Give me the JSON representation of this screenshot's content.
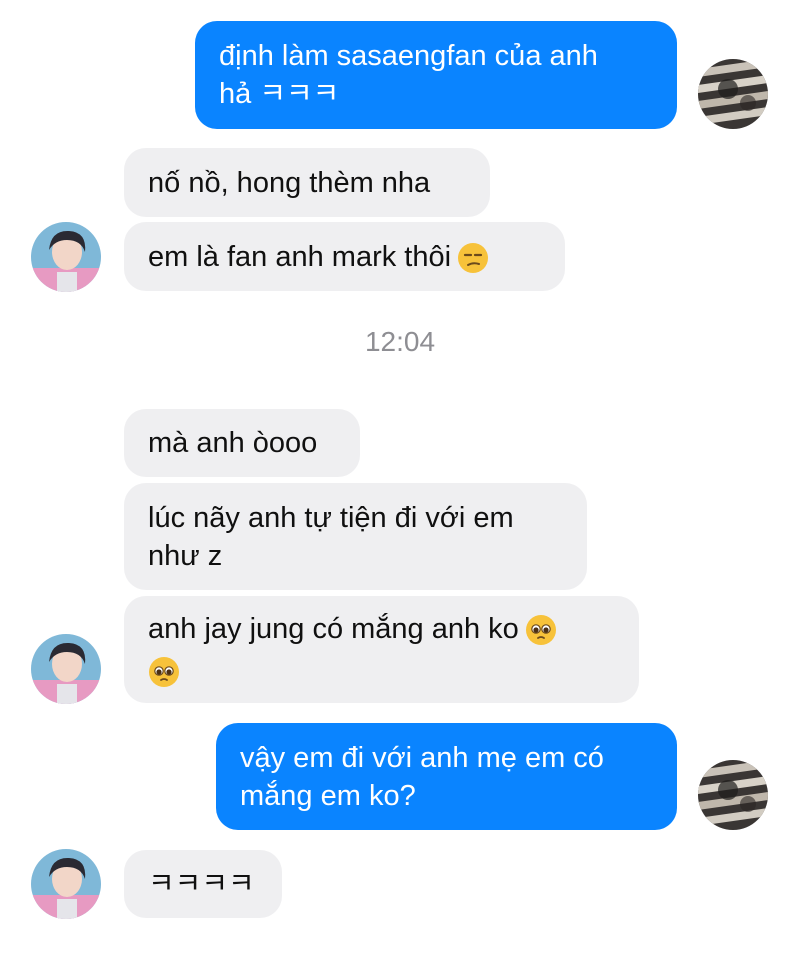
{
  "conversation": {
    "timestamp": "12:04",
    "messages": [
      {
        "lines": [
          "định làm sasaengfan của anh",
          "hả ㅋㅋㅋ"
        ]
      },
      {
        "lines": [
          "nố nồ, hong thèm nha"
        ]
      },
      {
        "lines": [
          "em là fan anh mark thôi"
        ],
        "emoji": "unamused-face-emoji"
      },
      {
        "lines": [
          "mà anh òooo"
        ]
      },
      {
        "lines": [
          "lúc nãy anh tự tiện đi với em",
          "như z"
        ]
      },
      {
        "lines": [
          "anh jay jung có mắng anh ko"
        ],
        "emoji": "pleading-face-emoji"
      },
      {
        "lines": [
          "vậy em đi với anh mẹ em có",
          "mắng em ko?"
        ]
      },
      {
        "lines": [
          "ㅋㅋㅋㅋ"
        ]
      }
    ]
  },
  "colors": {
    "outgoing_bubble": "#0a84ff",
    "incoming_bubble": "#efeff1",
    "timestamp_text": "#8e8e93"
  }
}
